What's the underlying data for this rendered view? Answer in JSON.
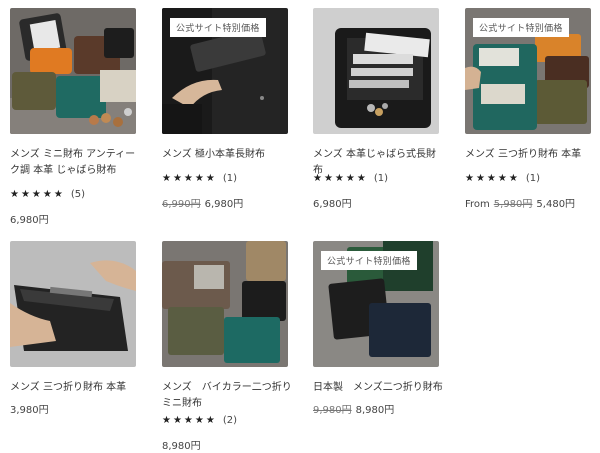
{
  "products": [
    {
      "title": "メンズ ミニ財布 アンティーク調 本革 じゃばら財布",
      "stars": "★★★★★",
      "count": "(5)",
      "price": "6,980円"
    },
    {
      "title": "メンズ 極小本革長財布",
      "stars": "★★★★★",
      "count": "(1)",
      "old_price": "6,990円",
      "price": "6,980円",
      "badge": "公式サイト特別価格"
    },
    {
      "title": "メンズ 本革じゃばら式長財布",
      "stars": "★★★★★",
      "count": "(1)",
      "price": "6,980円"
    },
    {
      "title": "メンズ 三つ折り財布 本革",
      "stars": "★★★★★",
      "count": "(1)",
      "from_label": "From",
      "old_price": "5,980円",
      "price": "5,480円",
      "badge": "公式サイト特別価格"
    },
    {
      "title": "メンズ 三つ折り財布 本革",
      "price": "3,980円"
    },
    {
      "title": "メンズ　バイカラー二つ折りミニ財布",
      "stars": "★★★★★",
      "count": "(2)",
      "price": "8,980円"
    },
    {
      "title": "日本製　メンズ二つ折り財布",
      "old_price": "9,980円",
      "price": "8,980円",
      "badge": "公式サイト特別価格"
    }
  ]
}
